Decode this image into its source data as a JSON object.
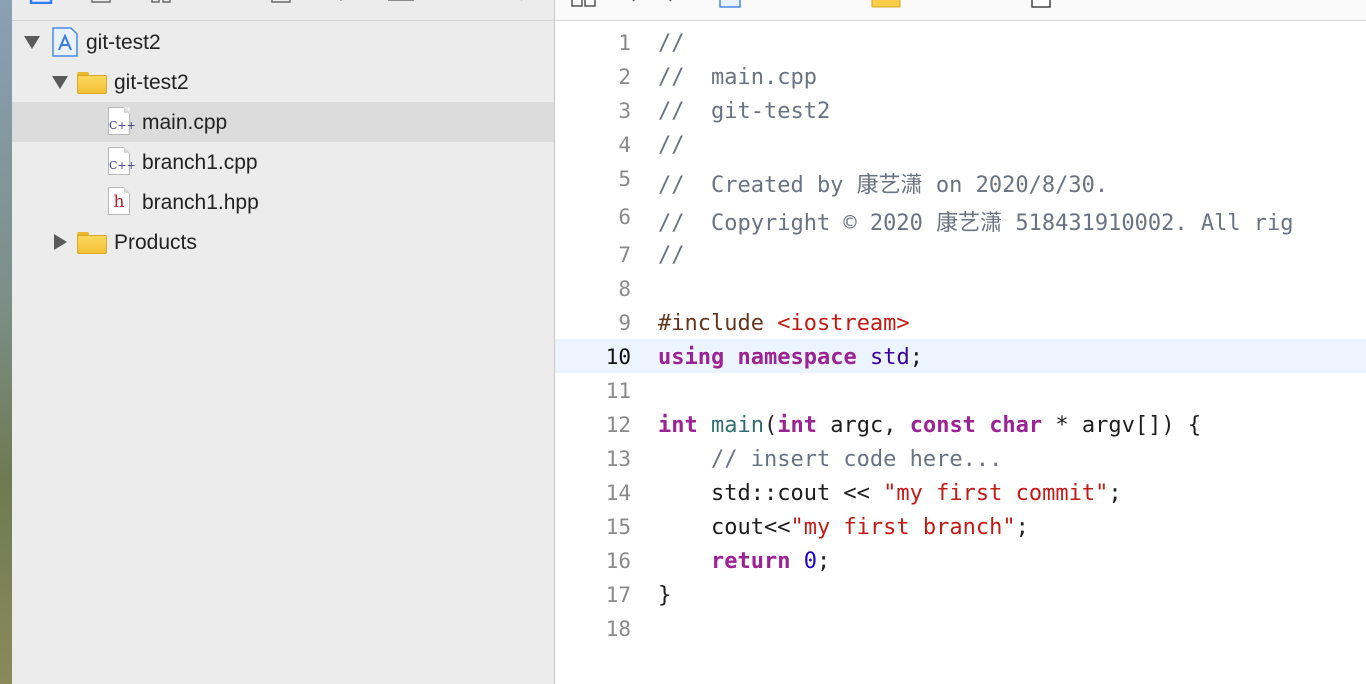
{
  "navigator": {
    "items": [
      {
        "label": "git-test2",
        "kind": "project",
        "expanded": true,
        "depth": 0,
        "selected": false
      },
      {
        "label": "git-test2",
        "kind": "folder",
        "expanded": true,
        "depth": 1,
        "selected": false
      },
      {
        "label": "main.cpp",
        "kind": "cpp-file",
        "depth": 2,
        "selected": true
      },
      {
        "label": "branch1.cpp",
        "kind": "cpp-file",
        "depth": 2,
        "selected": false
      },
      {
        "label": "branch1.hpp",
        "kind": "header-file",
        "depth": 2,
        "selected": false
      },
      {
        "label": "Products",
        "kind": "folder",
        "expanded": false,
        "depth": 1,
        "selected": false
      }
    ],
    "icons": {
      "cpp-file": "C++",
      "header-file": "h"
    }
  },
  "editor": {
    "current_line": 10,
    "lines": [
      {
        "n": "1",
        "tokens": [
          [
            "comment",
            "//"
          ]
        ]
      },
      {
        "n": "2",
        "tokens": [
          [
            "comment",
            "//  main.cpp"
          ]
        ]
      },
      {
        "n": "3",
        "tokens": [
          [
            "comment",
            "//  git-test2"
          ]
        ]
      },
      {
        "n": "4",
        "tokens": [
          [
            "comment",
            "//"
          ]
        ]
      },
      {
        "n": "5",
        "tokens": [
          [
            "comment",
            "//  Created by 康艺潇 on 2020/8/30."
          ]
        ]
      },
      {
        "n": "6",
        "tokens": [
          [
            "comment",
            "//  Copyright © 2020 康艺潇 518431910002. All rig"
          ]
        ]
      },
      {
        "n": "7",
        "tokens": [
          [
            "comment",
            "//"
          ]
        ]
      },
      {
        "n": "8",
        "tokens": []
      },
      {
        "n": "9",
        "tokens": [
          [
            "preproc",
            "#include "
          ],
          [
            "string",
            "<iostream>"
          ]
        ]
      },
      {
        "n": "10",
        "tokens": [
          [
            "keyword",
            "using"
          ],
          [
            "plain",
            " "
          ],
          [
            "keyword",
            "namespace"
          ],
          [
            "plain",
            " "
          ],
          [
            "type",
            "std"
          ],
          [
            "plain",
            ";"
          ]
        ]
      },
      {
        "n": "11",
        "tokens": []
      },
      {
        "n": "12",
        "tokens": [
          [
            "keyword",
            "int"
          ],
          [
            "plain",
            " "
          ],
          [
            "func",
            "main"
          ],
          [
            "plain",
            "("
          ],
          [
            "keyword",
            "int"
          ],
          [
            "plain",
            " argc, "
          ],
          [
            "keyword",
            "const"
          ],
          [
            "plain",
            " "
          ],
          [
            "keyword",
            "char"
          ],
          [
            "plain",
            " * argv[]) {"
          ]
        ]
      },
      {
        "n": "13",
        "tokens": [
          [
            "plain",
            "    "
          ],
          [
            "comment",
            "// insert code here..."
          ]
        ]
      },
      {
        "n": "14",
        "tokens": [
          [
            "plain",
            "    std::cout << "
          ],
          [
            "string",
            "\"my first commit\""
          ],
          [
            "plain",
            ";"
          ]
        ]
      },
      {
        "n": "15",
        "tokens": [
          [
            "plain",
            "    cout<<"
          ],
          [
            "string",
            "\"my first branch\""
          ],
          [
            "plain",
            ";"
          ]
        ]
      },
      {
        "n": "16",
        "tokens": [
          [
            "plain",
            "    "
          ],
          [
            "keyword",
            "return"
          ],
          [
            "plain",
            " "
          ],
          [
            "number",
            "0"
          ],
          [
            "plain",
            ";"
          ]
        ]
      },
      {
        "n": "17",
        "tokens": [
          [
            "plain",
            "}"
          ]
        ]
      },
      {
        "n": "18",
        "tokens": []
      }
    ]
  },
  "colors": {
    "selection": "#dcdcdc",
    "current_line": "#ecf5ff",
    "keyword": "#9b2393",
    "string": "#c41a16",
    "comment": "#6c7380"
  }
}
